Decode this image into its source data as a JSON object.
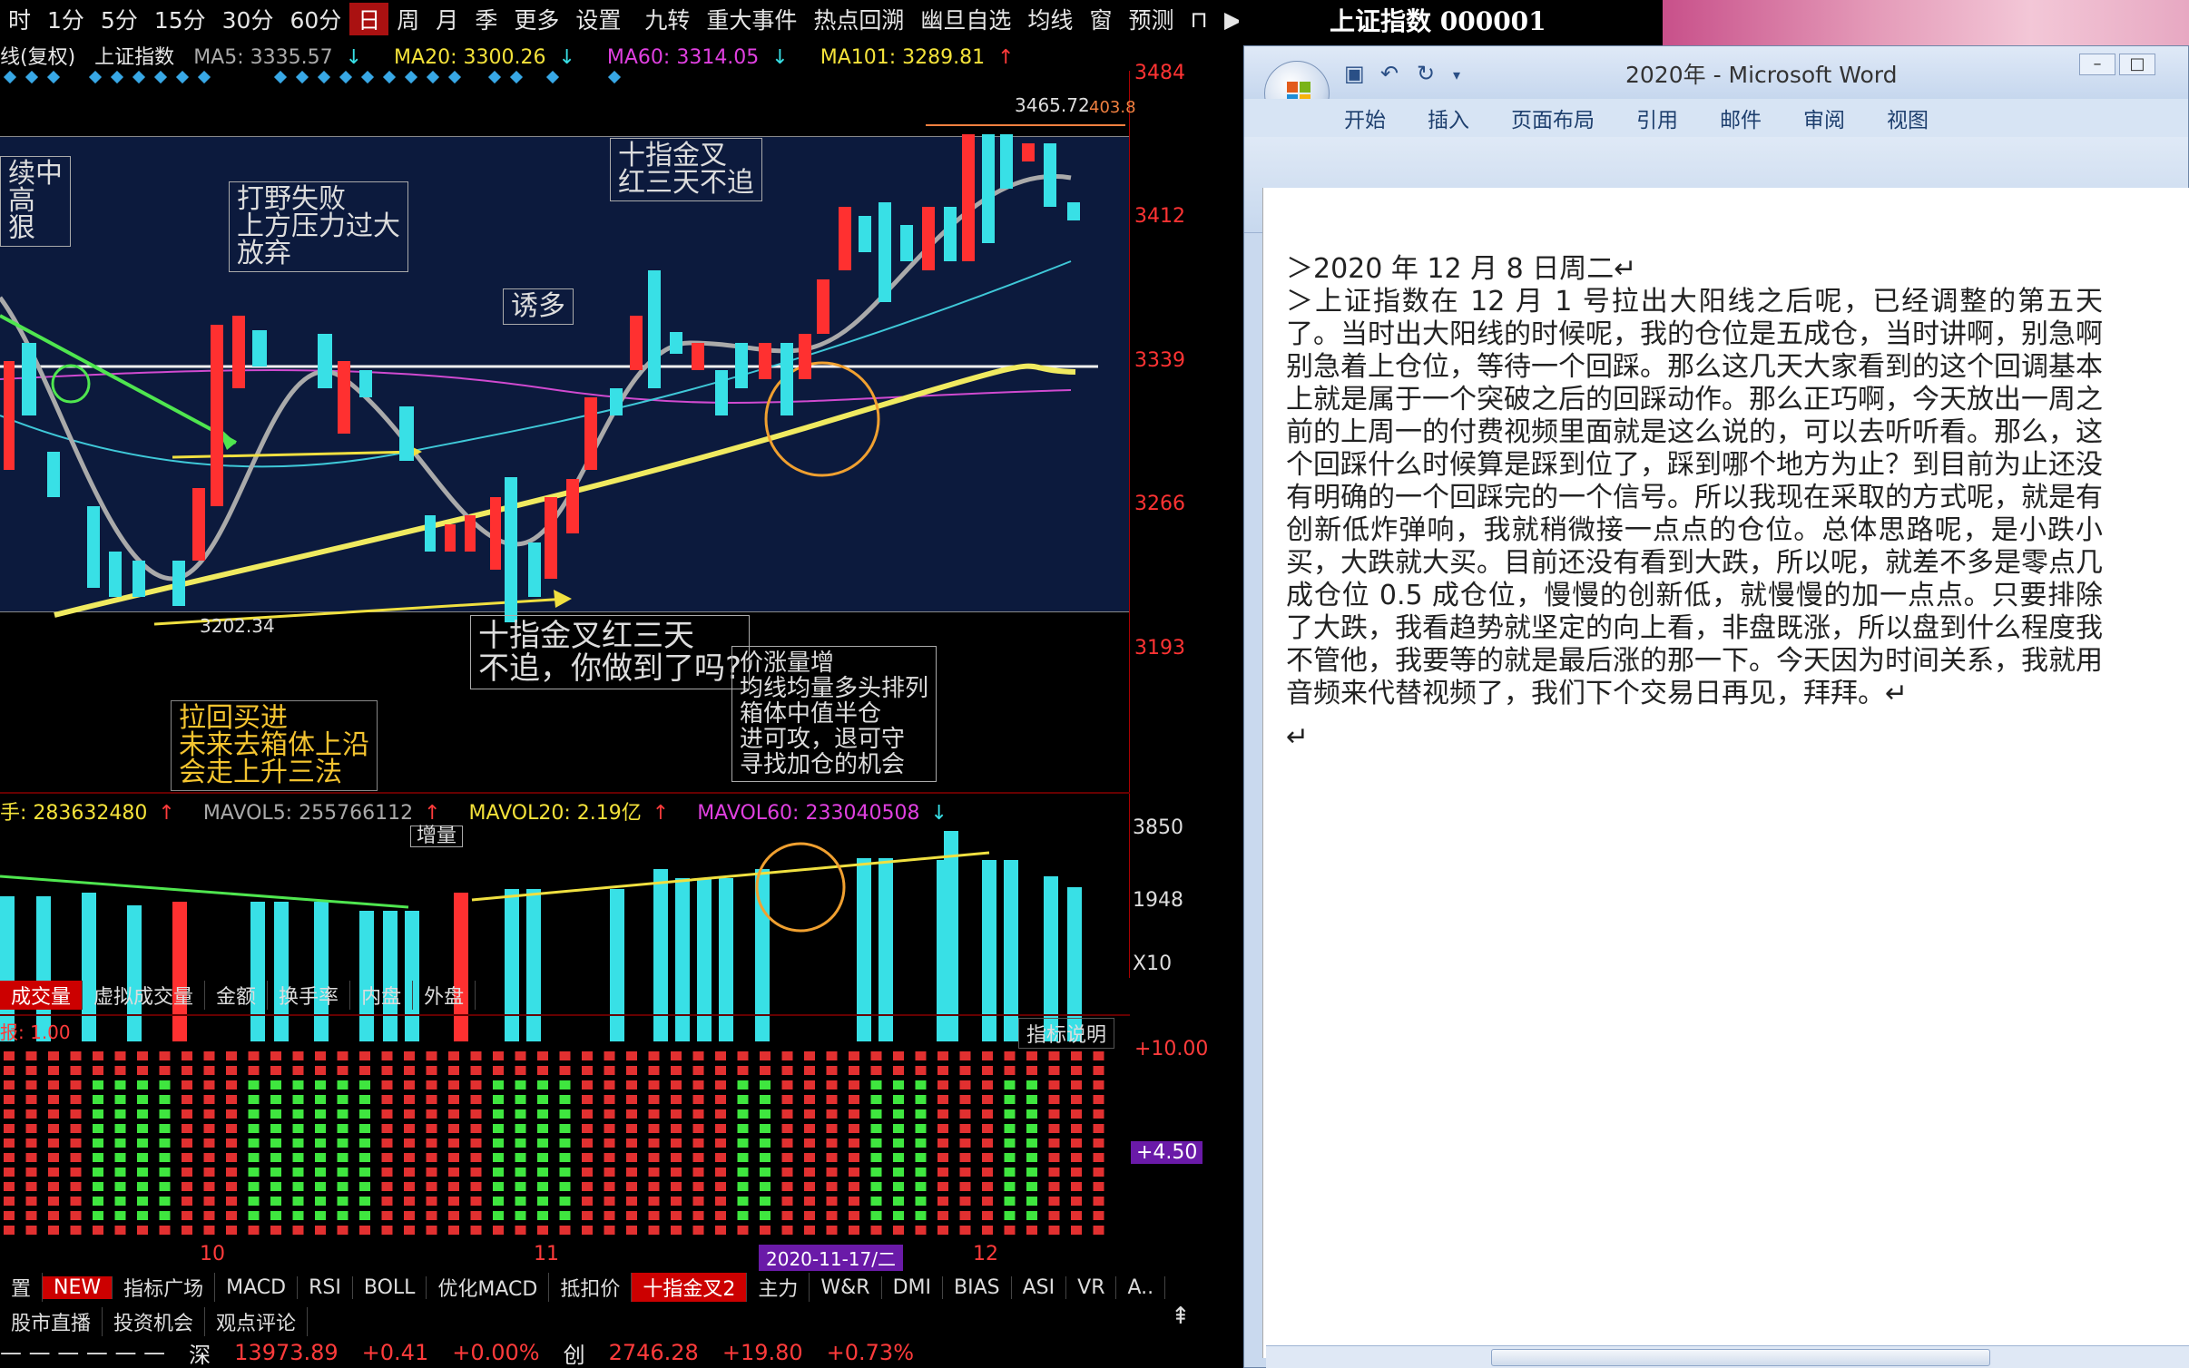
{
  "toolbar": {
    "items": [
      "时",
      "1分",
      "5分",
      "15分",
      "30分",
      "60分",
      "日",
      "周",
      "月",
      "季",
      "更多",
      "设置",
      "九转",
      "重大事件",
      "热点回溯",
      "幽旦自选",
      "均线",
      "窗",
      "预测"
    ],
    "active_index": 6,
    "lock_icon": "lock-icon",
    "arrow_icon": "right-arrow-icon"
  },
  "ma_line": {
    "prefix": "线(复权)",
    "name": "上证指数",
    "ma5": "MA5: 3335.57",
    "ma20": "MA20: 3300.26",
    "ma60": "MA60: 3314.05",
    "ma101": "MA101: 3289.81",
    "down_arrow": "↓",
    "up_arrow": "↑"
  },
  "price_axis": [
    "3484",
    "3412",
    "3339",
    "3266",
    "3193"
  ],
  "price_marks": {
    "high": "3465.72",
    "low": "3202.34",
    "right_cut": "403.8"
  },
  "annotations": {
    "a1": "续中\n高\n狠",
    "a2": "打野失败\n上方压力过大\n放弃",
    "a3": "诱多",
    "a4": "十指金叉\n红三天不追",
    "a5": "十指金叉红三天\n不追，你做到了吗?",
    "a6": "价涨量增\n均线均量多头排列\n箱体中值半仓\n进可攻，退可守\n寻找加仓的机会",
    "a7": "拉回买进\n未来去箱体上沿\n会走上升三法",
    "a8": "增量"
  },
  "volume_header": {
    "vol": "手: 283632480",
    "mavol5": "MAVOL5: 255766112",
    "mavol20": "MAVOL20: 2.19亿",
    "mavol60": "MAVOL60: 233040508"
  },
  "volume_axis": [
    "3850",
    "1948",
    "X10"
  ],
  "sub_tabs": [
    "成交量",
    "虚拟成交量",
    "金额",
    "换手率",
    "内盘",
    "外盘"
  ],
  "indicator": {
    "label": "报: 1.00",
    "explain": "指标说明",
    "axis_top": "+10.00",
    "axis_mid": "+4.50"
  },
  "date_axis": {
    "d1": "10",
    "d2": "11",
    "d3": "12",
    "cursor": "2020-11-17/二"
  },
  "indicator_tabs": [
    "置",
    "NEW",
    "指标广场",
    "MACD",
    "RSI",
    "BOLL",
    "优化MACD",
    "抵扣价",
    "十指金叉2",
    "主力",
    "W&R",
    "DMI",
    "BIAS",
    "ASI",
    "VR",
    "A.."
  ],
  "news_tabs": [
    "股市直播",
    "投资机会",
    "观点评论"
  ],
  "status": {
    "dashes": "— — — — — —",
    "sz_label": "深",
    "sz_value": "13973.89",
    "sz_change": "+0.41",
    "sz_pct": "+0.00%",
    "cy_label": "创",
    "cy_value": "2746.28",
    "cy_change": "+19.80",
    "cy_pct": "+0.73%"
  },
  "index_title": "上证指数 000001",
  "word": {
    "title": "2020年 - Microsoft Word",
    "tabs": [
      "开始",
      "插入",
      "页面布局",
      "引用",
      "邮件",
      "审阅",
      "视图"
    ],
    "para1": "＞2020 年 12 月 8 日周二↵",
    "para2": "＞上证指数在 12 月 1 号拉出大阳线之后呢，已经调整的第五天了。当时出大阳线的时候呢，我的仓位是五成仓，当时讲啊，别急啊别急着上仓位，等待一个回踩。那么这几天大家看到的这个回调基本上就是属于一个突破之后的回踩动作。那么正巧啊，今天放出一周之前的上周一的付费视频里面就是这么说的，可以去听听看。那么，这个回踩什么时候算是踩到位了，踩到哪个地方为止？到目前为止还没有明确的一个回踩完的一个信号。所以我现在采取的方式呢，就是有创新低炸弹响，我就稍微接一点点的仓位。总体思路呢，是小跌小买，大跌就大买。目前还没有看到大跌，所以呢，就差不多是零点几成仓位 0.5 成仓位，慢慢的创新低，就慢慢的加一点点。只要排除了大跌，我看趋势就坚定的向上看，非盘既涨，所以盘到什么程度我不管他，我要等的就是最后涨的那一下。今天因为时间关系，我就用音频来代替视频了，我们下个交易日再见，拜拜。↵",
    "para3": "↵"
  }
}
